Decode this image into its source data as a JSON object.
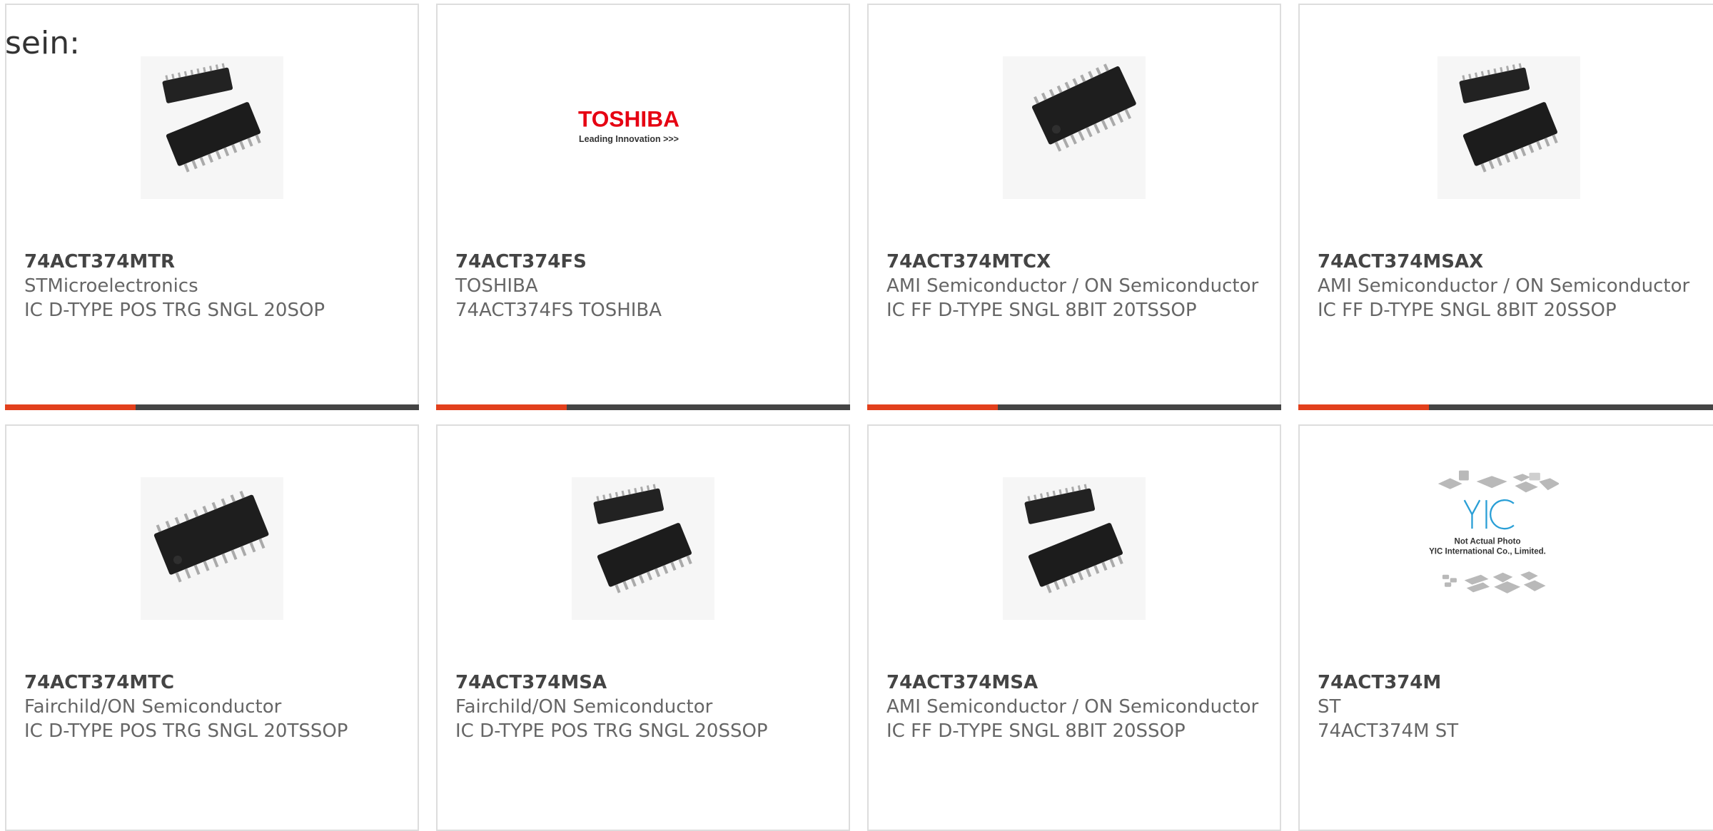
{
  "intro_text": "sein:",
  "colors": {
    "accent": "#e2401c",
    "bar": "#444444",
    "border": "#dddddd"
  },
  "products": [
    {
      "part": "74ACT374MTR",
      "maker": "STMicroelectronics",
      "desc": "IC D-TYPE POS TRG SNGL 20SOP",
      "image": "chip-ssop-pair-icon"
    },
    {
      "part": "74ACT374FS",
      "maker": "TOSHIBA",
      "desc": "74ACT374FS TOSHIBA",
      "image": "toshiba-logo",
      "logo_text": "TOSHIBA",
      "logo_tagline": "Leading Innovation >>>"
    },
    {
      "part": "74ACT374MTCX",
      "maker": "AMI Semiconductor / ON Semiconductor",
      "desc": "IC FF D-TYPE SNGL 8BIT 20TSSOP",
      "image": "chip-tssop-icon"
    },
    {
      "part": "74ACT374MSAX",
      "maker": "AMI Semiconductor / ON Semiconductor",
      "desc": "IC FF D-TYPE SNGL 8BIT 20SSOP",
      "image": "chip-ssop-pair-icon"
    },
    {
      "part": "74ACT374MTC",
      "maker": "Fairchild/ON Semiconductor",
      "desc": "IC D-TYPE POS TRG SNGL 20TSSOP",
      "image": "chip-tssop-icon"
    },
    {
      "part": "74ACT374MSA",
      "maker": "Fairchild/ON Semiconductor",
      "desc": "IC D-TYPE POS TRG SNGL 20SSOP",
      "image": "chip-ssop-pair-icon"
    },
    {
      "part": "74ACT374MSA",
      "maker": "AMI Semiconductor / ON Semiconductor",
      "desc": "IC FF D-TYPE SNGL 8BIT 20SSOP",
      "image": "chip-ssop-pair-icon"
    },
    {
      "part": "74ACT374M",
      "maker": "ST",
      "desc": "74ACT374M ST",
      "image": "yic-placeholder",
      "placeholder_line1": "Not Actual Photo",
      "placeholder_line2": "YIC International Co., Limited."
    }
  ]
}
